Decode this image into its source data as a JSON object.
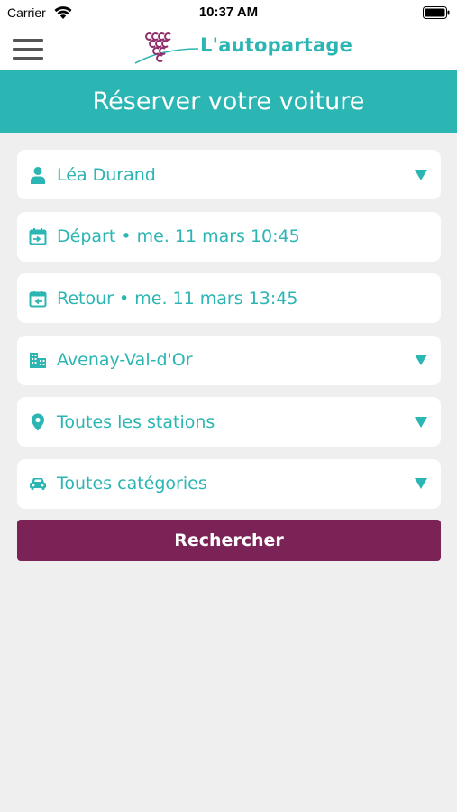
{
  "status_bar": {
    "carrier": "Carrier",
    "time": "10:37 AM",
    "icons": [
      "wifi-icon",
      "battery-icon"
    ]
  },
  "nav_bar": {
    "menu_icon": "menu-icon",
    "logo_text": "L'autopartage",
    "logo_icon": "grape-logo-icon"
  },
  "header": {
    "title": "Réserver votre voiture"
  },
  "form": {
    "fields": [
      {
        "icon": "person-icon",
        "label": "Léa Durand",
        "dropdown": true
      },
      {
        "icon": "calendar-departure-icon",
        "label": "Départ • me. 11 mars 10:45",
        "dropdown": false
      },
      {
        "icon": "calendar-return-icon",
        "label": "Retour • me. 11 mars 13:45",
        "dropdown": false
      },
      {
        "icon": "city-icon",
        "label": "Avenay-Val-d'Or",
        "dropdown": true
      },
      {
        "icon": "location-pin-icon",
        "label": "Toutes les stations",
        "dropdown": true
      },
      {
        "icon": "car-icon",
        "label": "Toutes catégories",
        "dropdown": true
      }
    ],
    "search_label": "Rechercher"
  },
  "colors": {
    "accent": "#2bb5b3",
    "button": "#7b2356",
    "background": "#efefef",
    "logo_grape": "#8e2f6b"
  }
}
